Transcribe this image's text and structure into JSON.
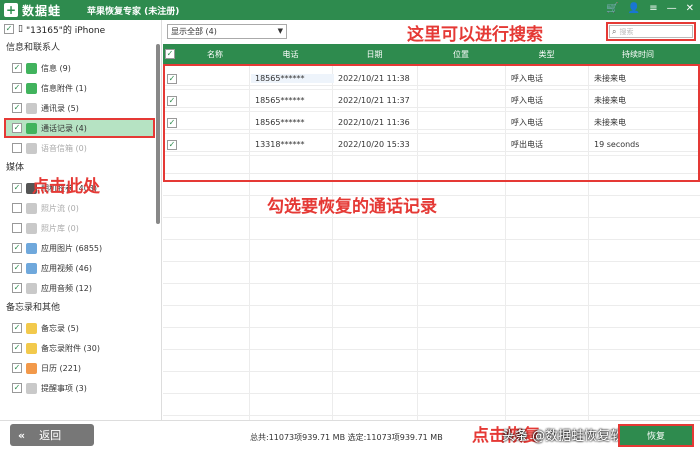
{
  "titlebar": {
    "logo_text": "数据蛙",
    "app_title": "苹果恢复专家 (未注册)",
    "controls": [
      "🛒",
      "👤",
      "≡",
      "—",
      "✕"
    ]
  },
  "sidebar": {
    "device_label": "\"13165\"的 iPhone",
    "sections": [
      {
        "title": "信息和联系人",
        "items": [
          {
            "label": "信息 (9)",
            "checked": true
          },
          {
            "label": "信息附件 (1)",
            "checked": true
          },
          {
            "label": "通讯录 (5)",
            "checked": true
          },
          {
            "label": "通话记录 (4)",
            "checked": true,
            "selected": true
          },
          {
            "label": "语音信箱 (0)",
            "checked": false,
            "dim": true
          }
        ]
      },
      {
        "title": "媒体",
        "items": [
          {
            "label": "相机胶卷 (403)",
            "checked": true
          },
          {
            "label": "照片流 (0)",
            "checked": false,
            "dim": true
          },
          {
            "label": "照片库 (0)",
            "checked": false,
            "dim": true
          },
          {
            "label": "应用图片 (6855)",
            "checked": true
          },
          {
            "label": "应用视频 (46)",
            "checked": true
          },
          {
            "label": "应用音频 (12)",
            "checked": true
          }
        ]
      },
      {
        "title": "备忘录和其他",
        "items": [
          {
            "label": "备忘录 (5)",
            "checked": true
          },
          {
            "label": "备忘录附件 (30)",
            "checked": true
          },
          {
            "label": "日历 (221)",
            "checked": true
          },
          {
            "label": "提醒事项 (3)",
            "checked": true
          }
        ]
      }
    ]
  },
  "toolbar": {
    "filter_value": "显示全部 (4)",
    "search_placeholder": "搜索",
    "search_hint": "这里可以进行搜索"
  },
  "table": {
    "headers": [
      "名称",
      "电话",
      "日期",
      "位置",
      "类型",
      "持续时间"
    ],
    "rows": [
      {
        "name": "",
        "phone": "18565******",
        "date": "2022/10/21 11:38",
        "location": "",
        "type": "呼入电话",
        "duration": "未接来电"
      },
      {
        "name": "",
        "phone": "18565******",
        "date": "2022/10/21 11:37",
        "location": "",
        "type": "呼入电话",
        "duration": "未接来电"
      },
      {
        "name": "",
        "phone": "18565******",
        "date": "2022/10/21 11:36",
        "location": "",
        "type": "呼入电话",
        "duration": "未接来电"
      },
      {
        "name": "",
        "phone": "13318******",
        "date": "2022/10/20 15:33",
        "location": "",
        "type": "呼出电话",
        "duration": "19 seconds"
      }
    ]
  },
  "annotations": {
    "click_here": "点击此处",
    "select_records": "勾选要恢复的通话记录",
    "click_recover": "点击恢复"
  },
  "footer": {
    "back_label": "返回",
    "totals": "总共:11073项939.71 MB 选定:11073项939.71 MB",
    "recover_label": "恢复",
    "watermark": "头条 @数据蛙恢复软件"
  }
}
